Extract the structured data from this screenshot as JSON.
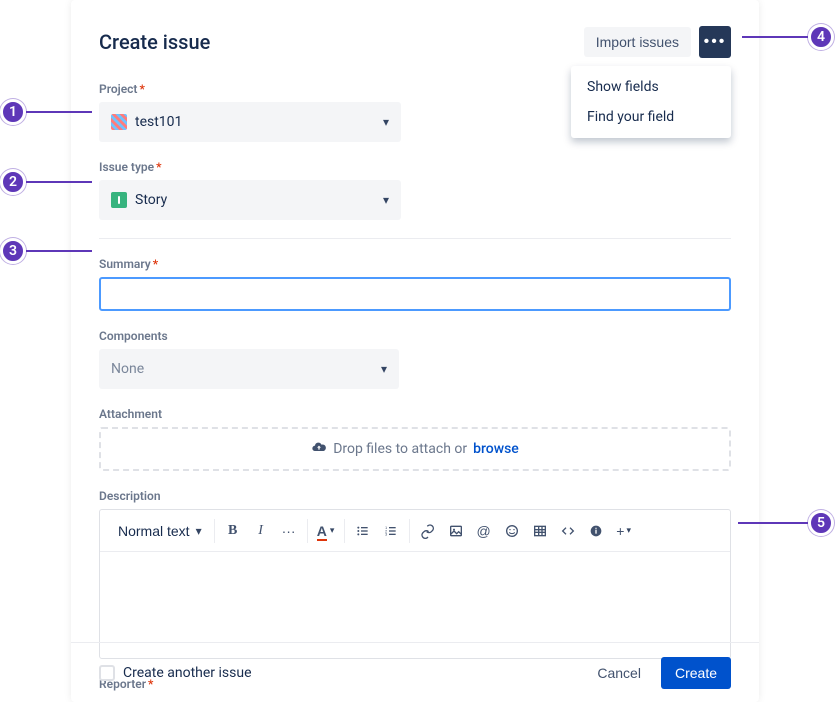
{
  "header": {
    "title": "Create issue",
    "import_label": "Import issues",
    "more_menu": {
      "show_fields": "Show fields",
      "find_field": "Find your field"
    }
  },
  "fields": {
    "project": {
      "label": "Project",
      "value": "test101"
    },
    "issue_type": {
      "label": "Issue type",
      "value": "Story"
    },
    "summary": {
      "label": "Summary",
      "value": "",
      "placeholder": "|"
    },
    "components": {
      "label": "Components",
      "value": "None"
    },
    "attachment": {
      "label": "Attachment",
      "drop_text": "Drop files to attach or",
      "browse": "browse"
    },
    "description": {
      "label": "Description"
    },
    "reporter": {
      "label": "Reporter"
    }
  },
  "toolbar": {
    "text_style": "Normal text"
  },
  "footer": {
    "create_another": "Create another issue",
    "cancel": "Cancel",
    "create": "Create"
  },
  "callouts": {
    "1": "1",
    "2": "2",
    "3": "3",
    "4": "4",
    "5": "5"
  }
}
